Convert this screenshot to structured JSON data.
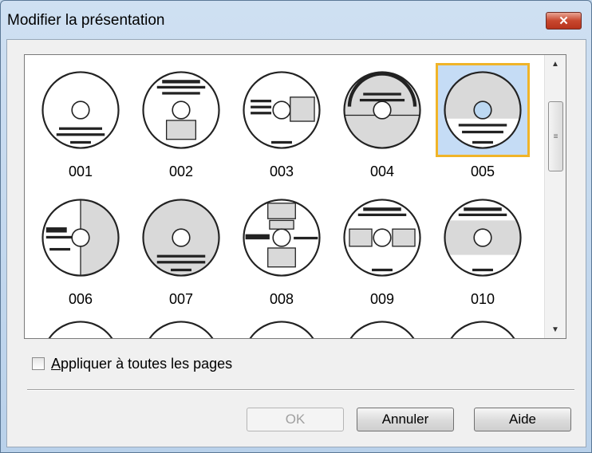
{
  "window": {
    "title": "Modifier la présentation",
    "close_glyph": "✕"
  },
  "layouts": [
    {
      "label": "001",
      "icon": "cd-layout-001-icon"
    },
    {
      "label": "002",
      "icon": "cd-layout-002-icon"
    },
    {
      "label": "003",
      "icon": "cd-layout-003-icon"
    },
    {
      "label": "004",
      "icon": "cd-layout-004-icon"
    },
    {
      "label": "005",
      "icon": "cd-layout-005-icon",
      "selected": true
    },
    {
      "label": "006",
      "icon": "cd-layout-006-icon"
    },
    {
      "label": "007",
      "icon": "cd-layout-007-icon"
    },
    {
      "label": "008",
      "icon": "cd-layout-008-icon"
    },
    {
      "label": "009",
      "icon": "cd-layout-009-icon"
    },
    {
      "label": "010",
      "icon": "cd-layout-010-icon"
    }
  ],
  "scrollbar": {
    "up_glyph": "▲",
    "down_glyph": "▼",
    "grip_glyph": "≡"
  },
  "apply_all": {
    "accel": "A",
    "rest": "ppliquer à toutes les pages",
    "checked": false
  },
  "buttons": {
    "ok": "OK",
    "cancel": "Annuler",
    "help": "Aide"
  },
  "colors": {
    "selection_fill": "#c5dcf5",
    "selection_border": "#f0b429",
    "disc_fill": "#d9d9d9"
  }
}
